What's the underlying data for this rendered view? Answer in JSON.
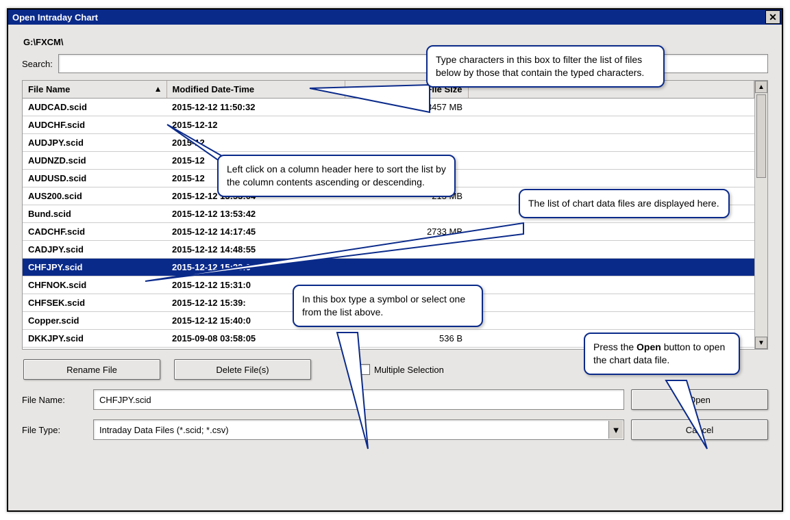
{
  "title": "Open Intraday Chart",
  "path": "G:\\FXCM\\",
  "search_label": "Search:",
  "columns": {
    "name": "File Name",
    "modified": "Modified Date-Time",
    "size": "File Size"
  },
  "files": [
    {
      "name": "AUDCAD.scid",
      "modified": "2015-12-12  11:50:32",
      "size": "3457 MB"
    },
    {
      "name": "AUDCHF.scid",
      "modified": "2015-12-12",
      "size": ""
    },
    {
      "name": "AUDJPY.scid",
      "modified": "2015-12",
      "size": ""
    },
    {
      "name": "AUDNZD.scid",
      "modified": "2015-12",
      "size": ""
    },
    {
      "name": "AUDUSD.scid",
      "modified": "2015-12",
      "size": ""
    },
    {
      "name": "AUS200.scid",
      "modified": "2015-12-12  13:53:04",
      "size": "213 MB"
    },
    {
      "name": "Bund.scid",
      "modified": "2015-12-12  13:53:42",
      "size": ""
    },
    {
      "name": "CADCHF.scid",
      "modified": "2015-12-12  14:17:45",
      "size": "2733 MB"
    },
    {
      "name": "CADJPY.scid",
      "modified": "2015-12-12  14:48:55",
      "size": ""
    },
    {
      "name": "CHFJPY.scid",
      "modified": "2015-12-12  15:23:0",
      "size": ""
    },
    {
      "name": "CHFNOK.scid",
      "modified": "2015-12-12  15:31:0",
      "size": ""
    },
    {
      "name": "CHFSEK.scid",
      "modified": "2015-12-12  15:39:",
      "size": ""
    },
    {
      "name": "Copper.scid",
      "modified": "2015-12-12  15:40:0",
      "size": ""
    },
    {
      "name": "DKKJPY.scid",
      "modified": "2015-09-08  03:58:05",
      "size": "536 B"
    }
  ],
  "selected_index": 9,
  "buttons": {
    "rename": "Rename File",
    "delete": "Delete File(s)",
    "open": "Open",
    "cancel": "Cancel"
  },
  "multiple_selection_label": "Multiple Selection",
  "filename_label": "File Name:",
  "filename_value": "CHFJPY.scid",
  "filetype_label": "File Type:",
  "filetype_value": "Intraday Data Files (*.scid; *.csv)",
  "callouts": {
    "c1": "Type characters in this box to filter the list of files below by those that contain the typed characters.",
    "c2": "Left click on a column header here to sort the list by the column contents ascending or descending.",
    "c3": "The list of chart data files are displayed here.",
    "c4": "In this box type a symbol or select one from the list above.",
    "c5_pre": "Press the ",
    "c5_bold": "Open",
    "c5_post": " button to open the chart data file."
  }
}
